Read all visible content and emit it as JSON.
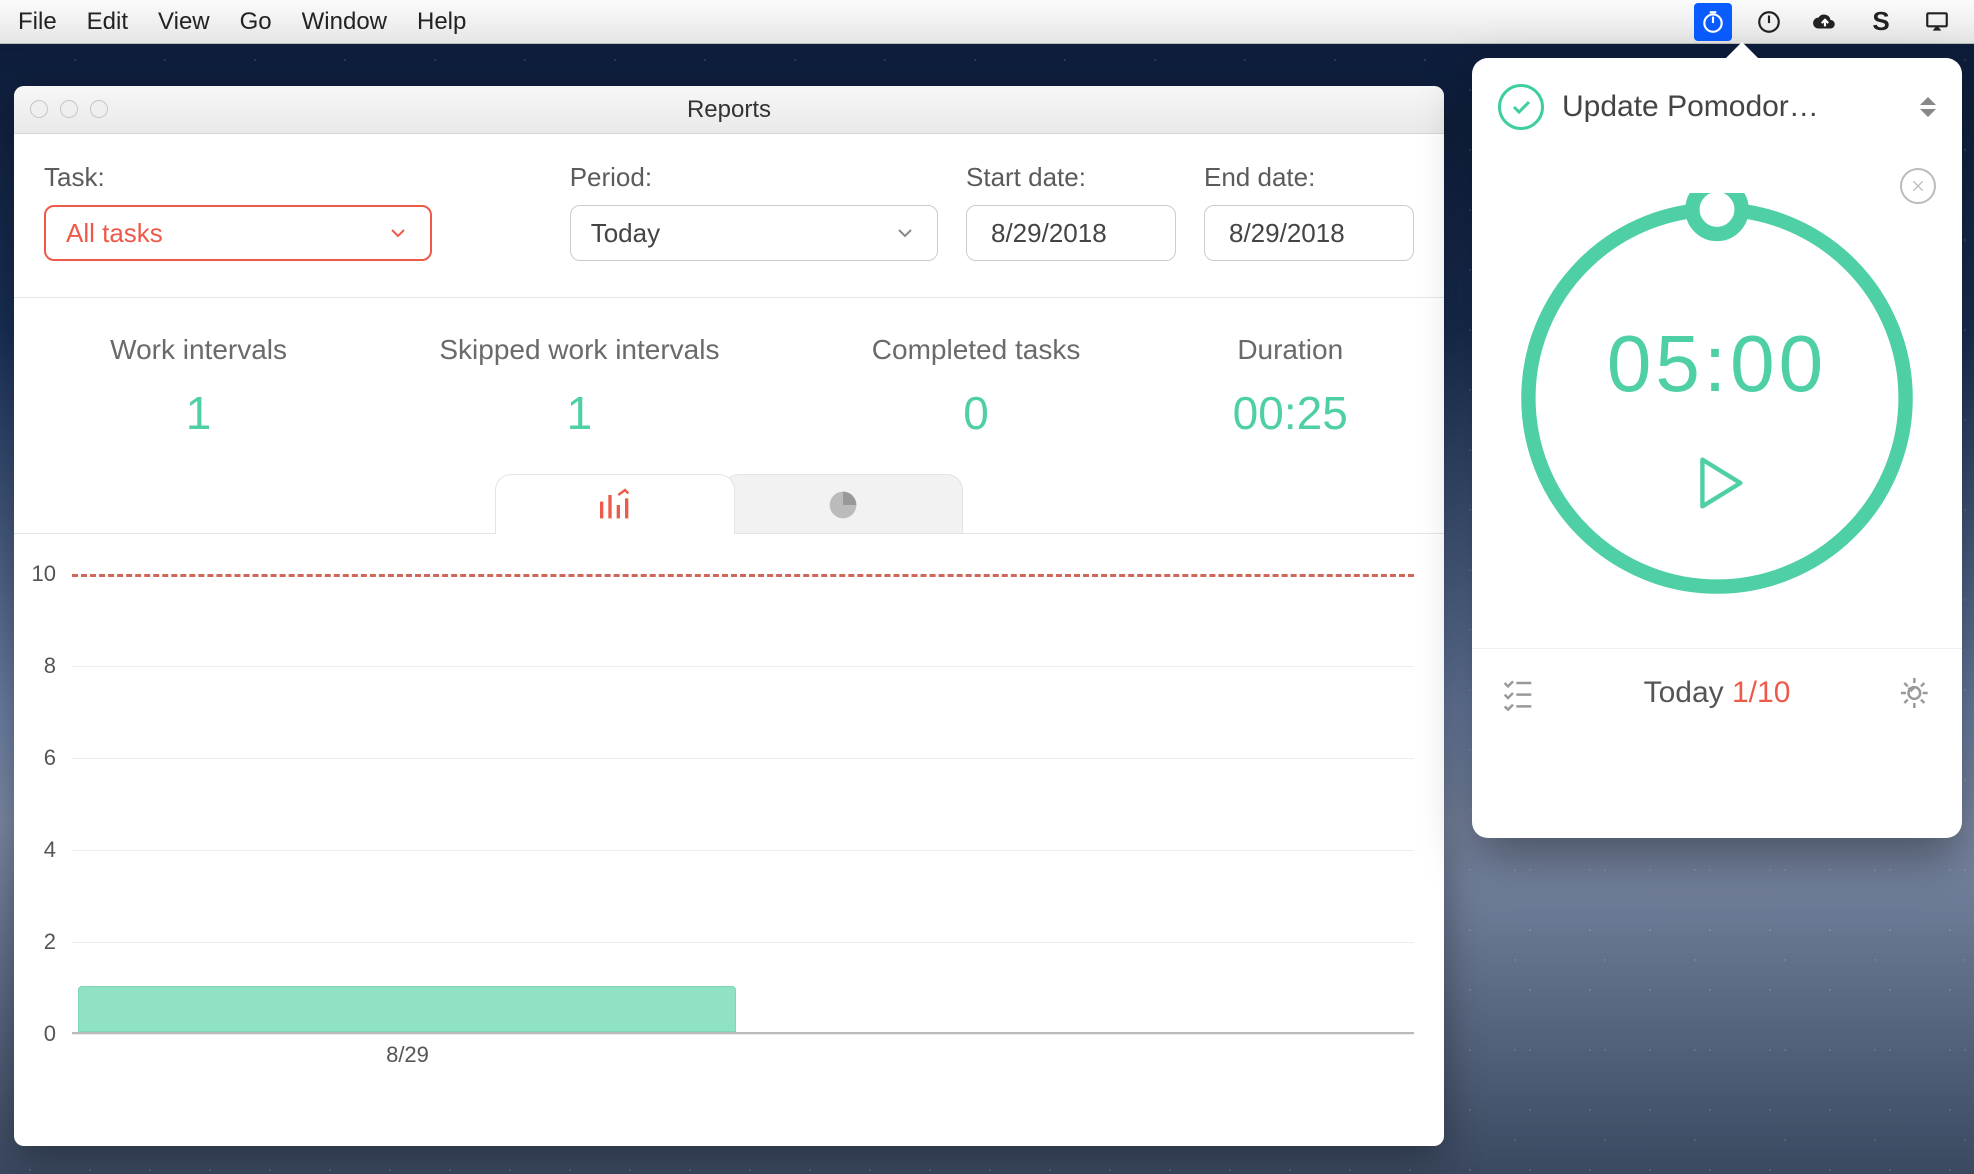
{
  "menubar": {
    "items": [
      "File",
      "Edit",
      "View",
      "Go",
      "Window",
      "Help"
    ]
  },
  "menu_icons": [
    "timer",
    "power",
    "cloud",
    "s",
    "airplay"
  ],
  "window": {
    "title": "Reports",
    "filters": {
      "task_label": "Task:",
      "task_value": "All tasks",
      "period_label": "Period:",
      "period_value": "Today",
      "start_label": "Start date:",
      "start_value": "8/29/2018",
      "end_label": "End date:",
      "end_value": "8/29/2018"
    },
    "stats": {
      "work_intervals_label": "Work intervals",
      "work_intervals_value": "1",
      "skipped_label": "Skipped work intervals",
      "skipped_value": "1",
      "completed_label": "Completed tasks",
      "completed_value": "0",
      "duration_label": "Duration",
      "duration_value": "00:25"
    }
  },
  "popover": {
    "task": "Update Pomodor…",
    "time": "05:00",
    "footer_label": "Today ",
    "footer_ratio": "1/10"
  },
  "chart_data": {
    "type": "bar",
    "categories": [
      "8/29"
    ],
    "values": [
      1
    ],
    "y_ticks": [
      0,
      2,
      4,
      6,
      8,
      10
    ],
    "ylim": [
      0,
      10
    ],
    "target_line": 10,
    "xlabel": "",
    "ylabel": "",
    "title": ""
  }
}
